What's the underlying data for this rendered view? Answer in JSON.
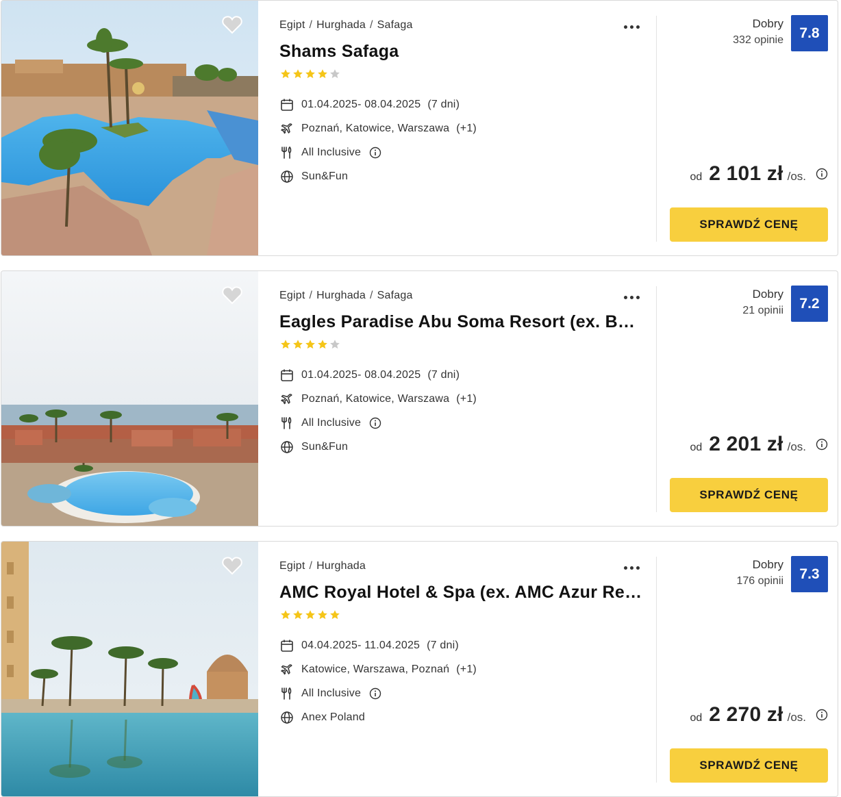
{
  "colors": {
    "score_badge": "#1f4fb8",
    "cta": "#f8cf3e",
    "star_on": "#f5c518",
    "star_off": "#c8c8c8"
  },
  "offers": [
    {
      "breadcrumb": [
        "Egipt",
        "Hurghada",
        "Safaga"
      ],
      "name": "Shams Safaga",
      "stars_of_5": 4,
      "dates": "01.04.2025- 08.04.2025",
      "duration": "(7 dni)",
      "departure": "Poznań, Katowice, Warszawa",
      "departure_extra": "(+1)",
      "board": "All Inclusive",
      "operator": "Sun&Fun",
      "rating_word": "Dobry",
      "reviews": "332 opinie",
      "score": "7.8",
      "price_prefix": "od",
      "price": "2 101 zł",
      "price_suffix": "/os.",
      "cta_label": "SPRAWDŹ CENĘ",
      "photo_icon": "hotel-photo-pool"
    },
    {
      "breadcrumb": [
        "Egipt",
        "Hurghada",
        "Safaga"
      ],
      "name": "Eagles Paradise Abu Soma Resort (ex. Ba…",
      "stars_of_5": 4,
      "dates": "01.04.2025- 08.04.2025",
      "duration": "(7 dni)",
      "departure": "Poznań, Katowice, Warszawa",
      "departure_extra": "(+1)",
      "board": "All Inclusive",
      "operator": "Sun&Fun",
      "rating_word": "Dobry",
      "reviews": "21 opinii",
      "score": "7.2",
      "price_prefix": "od",
      "price": "2 201 zł",
      "price_suffix": "/os.",
      "cta_label": "SPRAWDŹ CENĘ",
      "photo_icon": "hotel-photo-resort-sea"
    },
    {
      "breadcrumb": [
        "Egipt",
        "Hurghada"
      ],
      "name": "AMC Royal Hotel & Spa (ex. AMC Azur Res…",
      "stars_of_5": 5,
      "dates": "04.04.2025- 11.04.2025",
      "duration": "(7 dni)",
      "departure": "Katowice, Warszawa, Poznań",
      "departure_extra": "(+1)",
      "board": "All Inclusive",
      "operator": "Anex Poland",
      "rating_word": "Dobry",
      "reviews": "176 opinii",
      "score": "7.3",
      "price_prefix": "od",
      "price": "2 270 zł",
      "price_suffix": "/os.",
      "cta_label": "SPRAWDŹ CENĘ",
      "photo_icon": "hotel-photo-pool-palms"
    }
  ]
}
